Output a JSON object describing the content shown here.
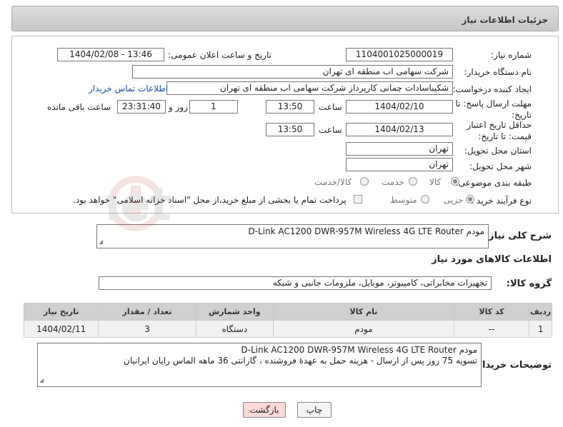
{
  "header": {
    "title": "جزئیات اطلاعات نیاز"
  },
  "form": {
    "need_number": {
      "label": "شماره نیاز:",
      "value": "1104001025000019"
    },
    "announce_datetime": {
      "label": "تاریخ و ساعت اعلان عمومی:",
      "value": "1404/02/08 - 13:46"
    },
    "buyer_org": {
      "label": "نام دستگاه خریدار:",
      "value": "شرکت سهامی اب منطقه ای تهران"
    },
    "requester": {
      "label": "ایجاد کننده درخواست:",
      "value": "شکیباسادات چمانی کارپرداز شرکت سهامی اب منطقه ای تهران",
      "contact_link": "اطلاعات تماس خریدار"
    },
    "reply_deadline": {
      "label": "مهلت ارسال پاسخ: تا تاریخ:",
      "date": "1404/02/10",
      "time_label": "ساعت",
      "time": "13:50",
      "days": "1",
      "days_label": "روز و",
      "remaining": "23:31:40",
      "remaining_label": "ساعت باقی مانده"
    },
    "price_validity": {
      "label": "حداقل تاریخ اعتبار قیمت: تا تاریخ:",
      "date": "1404/02/13",
      "time_label": "ساعت",
      "time": "13:50"
    },
    "delivery_province": {
      "label": "استان محل تحویل:",
      "value": "تهران"
    },
    "delivery_city": {
      "label": "شهر محل تحویل:",
      "value": "تهران"
    },
    "category": {
      "label": "طبقه بندی موضوعی:",
      "options": [
        "کالا",
        "خدمت",
        "کالا/خدمت"
      ],
      "selected": "کالا"
    },
    "purchase_process": {
      "label": "نوع فرآیند خرید :",
      "options": [
        "جزیی",
        "متوسط"
      ],
      "selected": "جزیی",
      "payment_note": "پرداخت تمام یا بخشی از مبلغ خرید،از محل \"اسناد خزانه اسلامی\" خواهد بود."
    }
  },
  "summary": {
    "label": "شرح کلی نیاز:",
    "value": "مودم  D-Link AC1200 DWR-957M Wireless 4G LTE Router"
  },
  "goods_info": {
    "title": "اطلاعات کالاهای مورد نیاز",
    "group_label": "گروه کالا:",
    "group_value": "تجهیزات مخابراتی، کامپیوتر، موبایل، ملزومات جانبی و شبکه"
  },
  "table": {
    "headers": [
      "ردیف",
      "کد کالا",
      "نام کالا",
      "واحد شمارش",
      "تعداد / مقدار",
      "تاریخ نیاز"
    ],
    "rows": [
      [
        "1",
        "--",
        "مودم",
        "دستگاه",
        "3",
        "1404/02/11"
      ]
    ]
  },
  "buyer_notes": {
    "label": "توضیحات خریدار:",
    "line1": "مودم D-Link AC1200 DWR-957M Wireless 4G LTE Router",
    "line2": "تسویه 75 روز پس از ارسال - هزینه حمل به عهدۀ فروشنده ، گارانتی 36 ماهه الماس رایان ایرانیان"
  },
  "buttons": {
    "print": "چاپ",
    "back": "بازگشت"
  },
  "watermark_text": "AriaTender.net"
}
